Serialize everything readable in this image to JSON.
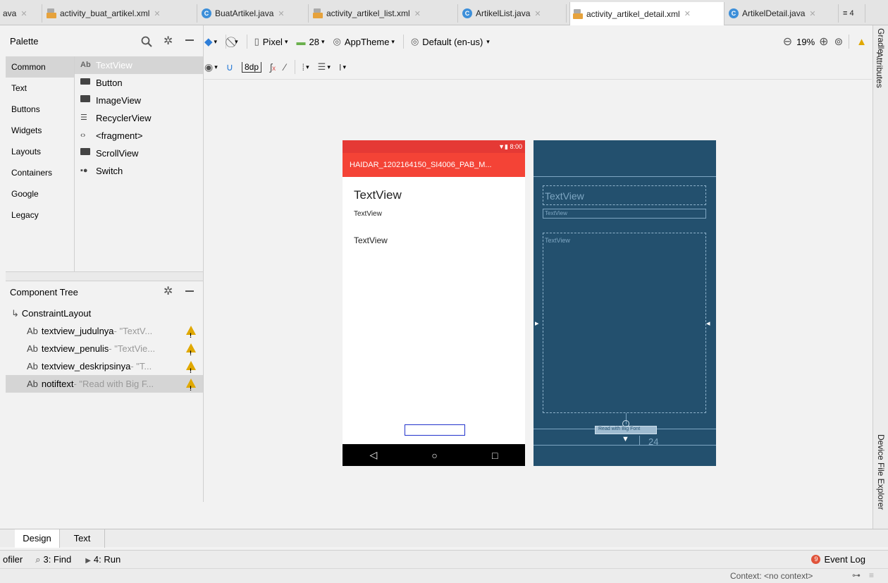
{
  "tabs": [
    {
      "label": "ava",
      "type": "partial"
    },
    {
      "label": "activity_buat_artikel.xml",
      "type": "xml"
    },
    {
      "label": "BuatArtikel.java",
      "type": "java"
    },
    {
      "label": "activity_artikel_list.xml",
      "type": "xml"
    },
    {
      "label": "ArtikelList.java",
      "type": "java"
    },
    {
      "label": "activity_artikel_detail.xml",
      "type": "xml",
      "active": true
    },
    {
      "label": "ArtikelDetail.java",
      "type": "java"
    }
  ],
  "tab_overflow": "≡ 4",
  "right_strip": {
    "gradle": "Gradle",
    "attributes": "Attributes",
    "device_file_explorer": "Device File Explorer"
  },
  "palette": {
    "title": "Palette",
    "categories": [
      "Common",
      "Text",
      "Buttons",
      "Widgets",
      "Layouts",
      "Containers",
      "Google",
      "Legacy"
    ],
    "items": [
      {
        "label": "TextView",
        "icon": "Ab"
      },
      {
        "label": "Button",
        "icon": "button-icon"
      },
      {
        "label": "ImageView",
        "icon": "image-icon"
      },
      {
        "label": "RecyclerView",
        "icon": "list-icon"
      },
      {
        "label": "<fragment>",
        "icon": "code-icon"
      },
      {
        "label": "ScrollView",
        "icon": "scroll-icon"
      },
      {
        "label": "Switch",
        "icon": "switch-icon"
      }
    ]
  },
  "component_tree": {
    "title": "Component Tree",
    "root": "ConstraintLayout",
    "children": [
      {
        "prefix": "Ab",
        "id": "textview_judulnya",
        "hint": "- \"TextV...",
        "warning": true
      },
      {
        "prefix": "Ab",
        "id": "textview_penulis",
        "hint": "- \"TextVie...",
        "warning": true
      },
      {
        "prefix": "Ab",
        "id": "textview_deskripsinya",
        "hint": "- \"T...",
        "warning": true
      },
      {
        "prefix": "Ab",
        "id": "notiftext",
        "hint": "- \"Read with Big F...",
        "warning": true,
        "selected": true
      }
    ]
  },
  "toolbar": {
    "device": "Pixel",
    "api": "28",
    "theme": "AppTheme",
    "locale": "Default (en-us)",
    "zoom": "19%",
    "margin": "8dp"
  },
  "phone": {
    "time": "8:00",
    "app_title": "HAIDAR_1202164150_SI4006_PAB_M...",
    "title_text": "TextView",
    "author_text": "TextView",
    "desc_text": "TextView"
  },
  "blueprint": {
    "title_text": "TextView",
    "author_text": "TextView",
    "desc_text": "TextView",
    "button_text": "Read with Big Font",
    "margin_value": "24"
  },
  "bottom_tabs": [
    "Design",
    "Text"
  ],
  "tool_windows": {
    "profiler": "ofiler",
    "find": "3: Find",
    "run": "4: Run",
    "event_log": "Event Log",
    "event_count": "9"
  },
  "status": {
    "context": "Context: <no context>"
  },
  "colors": {
    "appbar": "#f44336",
    "statusbar": "#e53935",
    "blueprint": "#23506e",
    "warning": "#e0a800"
  }
}
